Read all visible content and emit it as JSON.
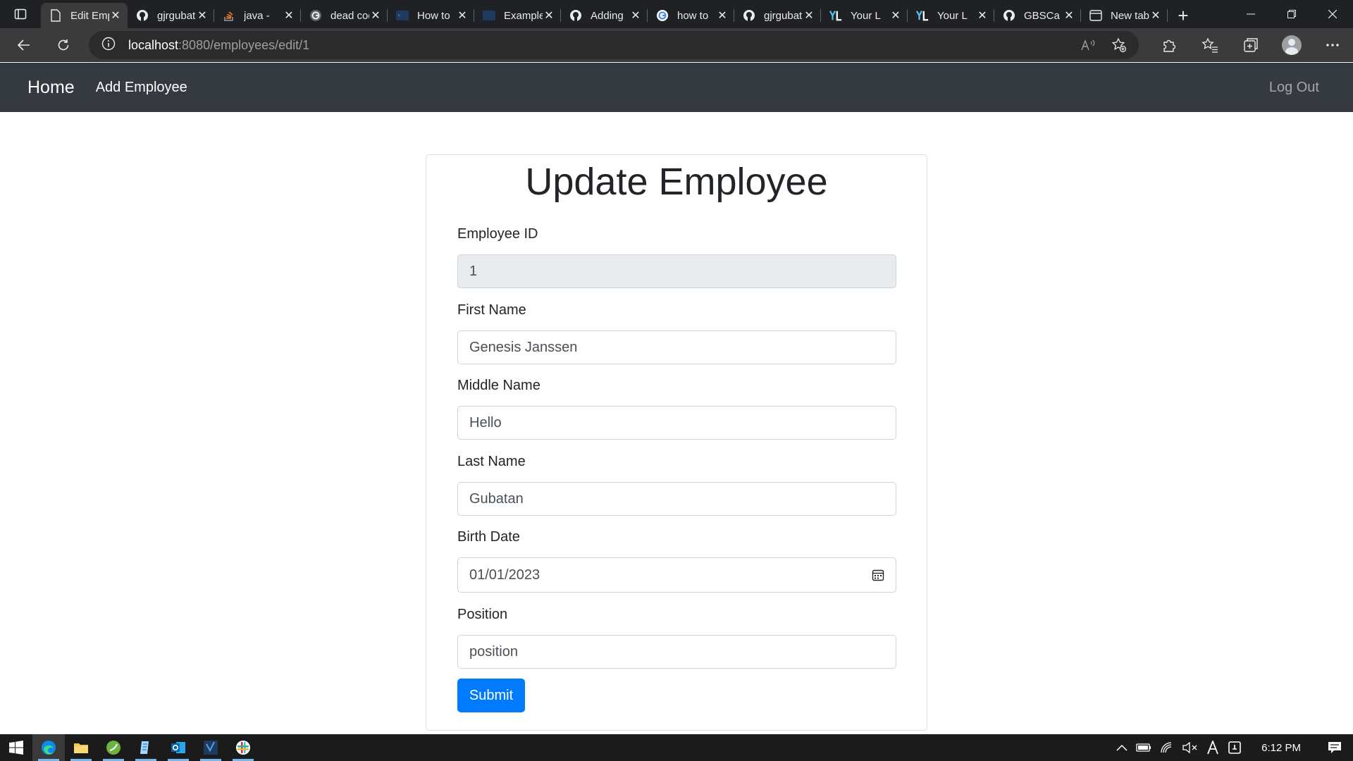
{
  "browser": {
    "tabs": [
      {
        "title": "Edit Employee",
        "icon": "page-icon",
        "active": true
      },
      {
        "title": "gjrgubatan",
        "icon": "github-icon"
      },
      {
        "title": "java - ",
        "icon": "stackoverflow-icon"
      },
      {
        "title": "dead code",
        "icon": "google-icon"
      },
      {
        "title": "How to",
        "icon": "code-icon"
      },
      {
        "title": "Example",
        "icon": "code-icon"
      },
      {
        "title": "Adding",
        "icon": "github-icon"
      },
      {
        "title": "how to",
        "icon": "google-icon"
      },
      {
        "title": "gjrgubatan",
        "icon": "github-icon"
      },
      {
        "title": "Your L",
        "icon": "yl-icon"
      },
      {
        "title": "Your L",
        "icon": "yl-icon"
      },
      {
        "title": "GBSCa",
        "icon": "github-icon"
      },
      {
        "title": "New tab",
        "icon": "newtab-icon"
      }
    ],
    "close_glyph": "✕",
    "new_tab_glyph": "+",
    "address": {
      "host": "localhost",
      "path": ":8080/employees/edit/1"
    }
  },
  "navbar": {
    "brand": "Home",
    "links": [
      "Add Employee"
    ],
    "logout": "Log Out"
  },
  "form": {
    "title": "Update Employee",
    "fields": [
      {
        "label": "Employee ID",
        "value": "1",
        "readonly": true
      },
      {
        "label": "First Name",
        "value": "Genesis Janssen"
      },
      {
        "label": "Middle Name",
        "value": "Hello"
      },
      {
        "label": "Last Name",
        "value": "Gubatan"
      },
      {
        "label": "Birth Date",
        "value": "01/01/2023",
        "type": "date"
      },
      {
        "label": "Position",
        "value": "position"
      }
    ],
    "submit_label": "Submit",
    "accent_color": "#007bff"
  },
  "taskbar": {
    "pinned": [
      "start-icon",
      "edge-icon",
      "file-explorer-icon",
      "spring-icon",
      "notepad-icon",
      "outlook-icon",
      "visual-studio-icon",
      "slack-icon"
    ],
    "clock": "6:12 PM"
  }
}
